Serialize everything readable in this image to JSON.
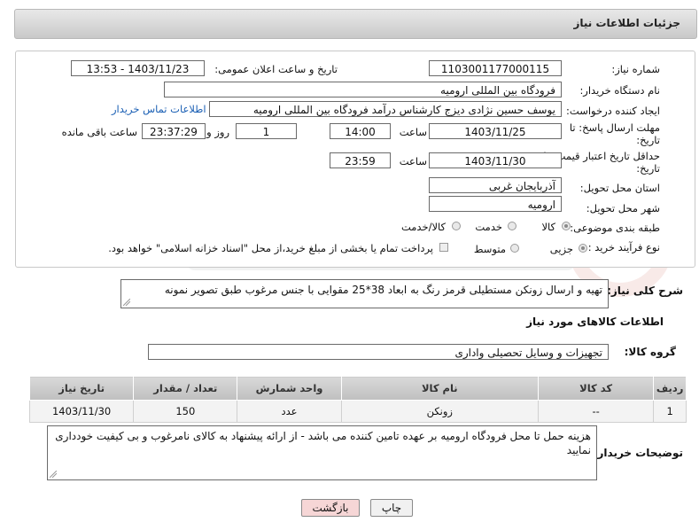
{
  "header": {
    "title": "جزئیات اطلاعات نیاز"
  },
  "form": {
    "need_number_label": "شماره نیاز:",
    "need_number": "1103001177000115",
    "announce_label": "تاریخ و ساعت اعلان عمومی:",
    "announce_value": "1403/11/23 - 13:53",
    "buyer_org_label": "نام دستگاه خریدار:",
    "buyer_org": "فرودگاه بین المللی ارومیه",
    "creator_label": "ایجاد کننده درخواست:",
    "creator": "یوسف حسین نژادی دیزج کارشناس درآمد فرودگاه بین المللی ارومیه",
    "contact_link": "اطلاعات تماس خریدار",
    "reply_deadline_label_1": "مهلت ارسال پاسخ: تا",
    "reply_deadline_label_2": "تاریخ:",
    "reply_date": "1403/11/25",
    "time_label": "ساعت",
    "reply_time": "14:00",
    "days_value": "1",
    "days_label": "روز و",
    "remaining_time": "23:37:29",
    "remaining_label": "ساعت باقی مانده",
    "price_validity_label_1": "حداقل تاریخ اعتبار قیمت: تا",
    "price_validity_label_2": "تاریخ:",
    "validity_date": "1403/11/30",
    "validity_time": "23:59",
    "province_label": "استان محل تحویل:",
    "province": "آذربایجان غربی",
    "city_label": "شهر محل تحویل:",
    "city": "ارومیه",
    "category_label": "طبقه بندی موضوعی:",
    "category_options": [
      "کالا",
      "خدمت",
      "کالا/خدمت"
    ],
    "process_label": "نوع فرآیند خرید :",
    "process_options": [
      "جزیی",
      "متوسط"
    ],
    "payment_note": "پرداخت تمام یا بخشی از مبلغ خرید،از محل \"اسناد خزانه اسلامی\" خواهد بود."
  },
  "description": {
    "label": "شرح کلی نیاز:",
    "text": "تهیه و ارسال زونکن مستطیلی قرمز رنگ به ابعاد 38*25 مقوایی با جنس مرغوب طبق تصویر نمونه"
  },
  "goods": {
    "section_title": "اطلاعات کالاهای مورد نیاز",
    "group_label": "گروه کالا:",
    "group_value": "تجهیزات و وسایل تحصیلی واداری",
    "columns": [
      "ردیف",
      "کد کالا",
      "نام کالا",
      "واحد شمارش",
      "تعداد / مقدار",
      "تاریخ نیاز"
    ],
    "rows": [
      [
        "1",
        "--",
        "زونکن",
        "عدد",
        "150",
        "1403/11/30"
      ]
    ]
  },
  "buyer_notes": {
    "label": "توضیحات خریدار:",
    "text": "هزینه حمل تا محل فرودگاه ارومیه بر عهده تامین کننده می باشد - از ارائه پیشنهاد به کالای نامرغوب و بی کیفیت خودداری نمایید"
  },
  "buttons": {
    "print": "چاپ",
    "back": "بازگشت"
  },
  "colors": {
    "back_button_bg": "#f6d6d6",
    "link": "#1a5fb4"
  }
}
